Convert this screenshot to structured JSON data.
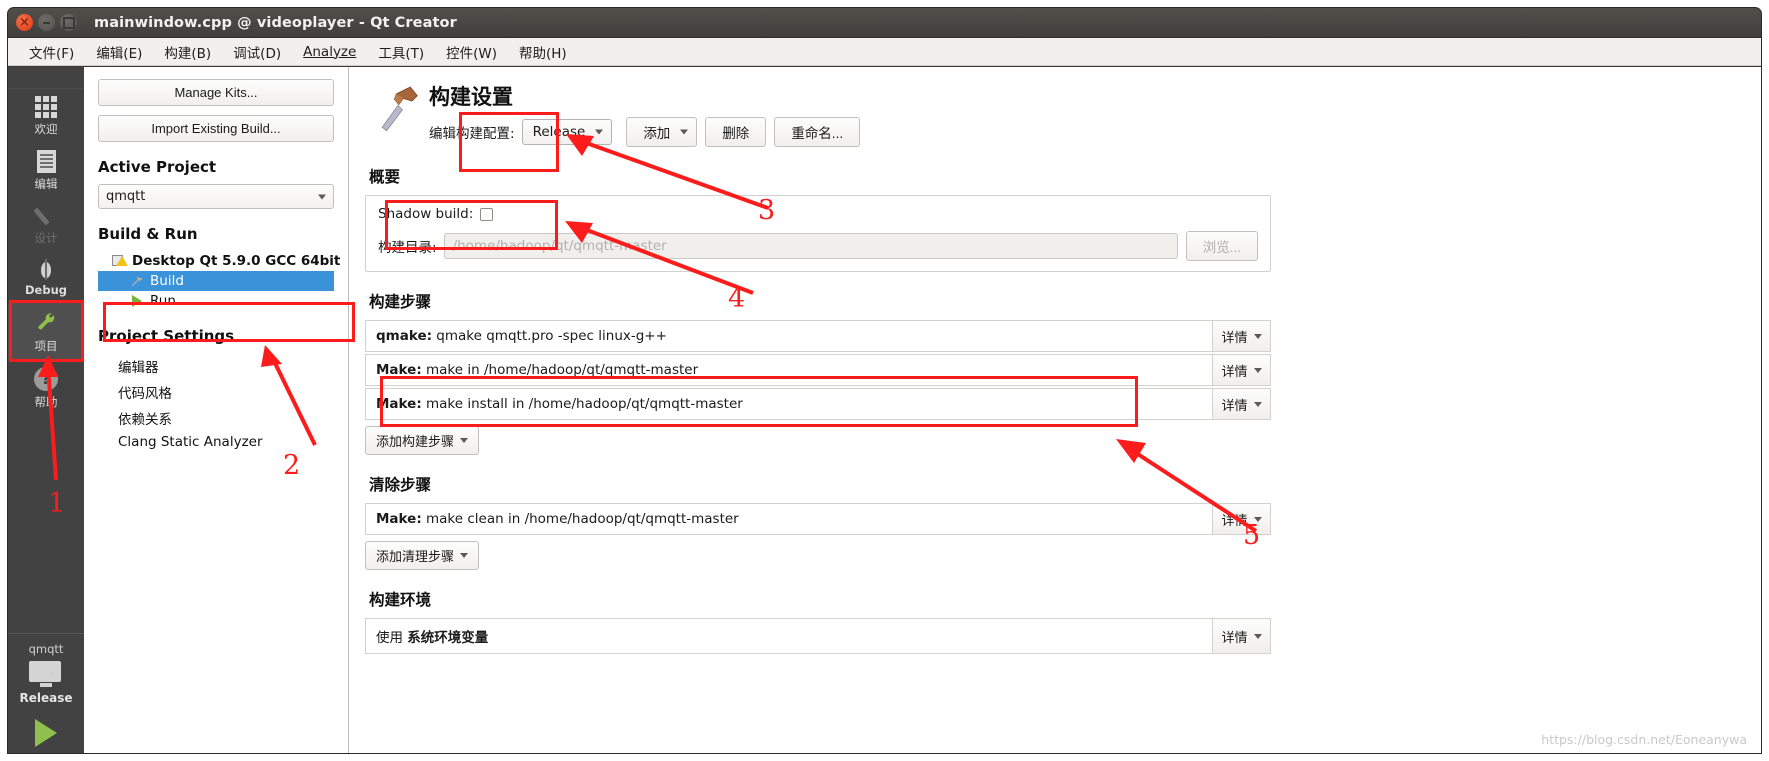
{
  "window": {
    "title": "mainwindow.cpp @ videoplayer - Qt Creator",
    "controls": {
      "close": "close-button",
      "minimize": "minimize-button",
      "maximize": "maximize-button"
    }
  },
  "menubar": {
    "items": [
      {
        "label": "文件(F)",
        "mnemonic": "F"
      },
      {
        "label": "编辑(E)",
        "mnemonic": "E"
      },
      {
        "label": "构建(B)",
        "mnemonic": "B"
      },
      {
        "label": "调试(D)",
        "mnemonic": "D"
      },
      {
        "label": "Analyze",
        "mnemonic": "A"
      },
      {
        "label": "工具(T)",
        "mnemonic": "T"
      },
      {
        "label": "控件(W)",
        "mnemonic": "W"
      },
      {
        "label": "帮助(H)",
        "mnemonic": "H"
      }
    ]
  },
  "mode_bar": {
    "items": [
      {
        "label": "欢迎",
        "icon": "grid-icon",
        "state": "normal"
      },
      {
        "label": "编辑",
        "icon": "document-icon",
        "state": "normal"
      },
      {
        "label": "设计",
        "icon": "pencil-icon",
        "state": "disabled"
      },
      {
        "label": "Debug",
        "icon": "bug-icon",
        "state": "normal"
      },
      {
        "label": "项目",
        "icon": "wrench-icon",
        "state": "selected"
      },
      {
        "label": "帮助",
        "icon": "question-mark-icon",
        "state": "normal"
      }
    ],
    "kit_selector": {
      "project": "qmqtt",
      "build_config": "Release",
      "icon": "monitor-icon",
      "run_icon": "run-triangle-icon"
    }
  },
  "project_panel": {
    "manage_kits_label": "Manage Kits...",
    "import_existing_build_label": "Import Existing Build...",
    "active_project_heading": "Active Project",
    "active_project_value": "qmqtt",
    "build_and_run_heading": "Build & Run",
    "kit_name": "Desktop Qt 5.9.0 GCC 64bit",
    "kit_children": [
      {
        "label": "Build",
        "selected": true,
        "icon": "hammer-icon"
      },
      {
        "label": "Run",
        "selected": false,
        "icon": "run-triangle-icon"
      }
    ],
    "project_settings_heading": "Project Settings",
    "project_settings_items": [
      "编辑器",
      "代码风格",
      "依赖关系",
      "Clang Static Analyzer"
    ]
  },
  "build_settings": {
    "title": "构建设置",
    "icon": "hammer-icon",
    "edit_config_label": "编辑构建配置:",
    "config_value": "Release",
    "add_label": "添加",
    "delete_label": "删除",
    "rename_label": "重命名...",
    "summary": {
      "heading": "概要",
      "shadow_build_label": "Shadow build:",
      "shadow_build_checked": false,
      "build_dir_label": "构建目录:",
      "build_dir_value": "/home/hadoop/qt/qmqtt-master",
      "browse_label": "浏览..."
    },
    "build_steps": {
      "heading": "构建步骤",
      "detail_label": "详情",
      "add_step_label": "添加构建步骤",
      "steps": [
        {
          "prefix": "qmake:",
          "text": " qmake qmqtt.pro -spec linux-g++"
        },
        {
          "prefix": "Make:",
          "text": " make in /home/hadoop/qt/qmqtt-master"
        },
        {
          "prefix": "Make:",
          "text": " make install in /home/hadoop/qt/qmqtt-master"
        }
      ]
    },
    "clean_steps": {
      "heading": "清除步骤",
      "detail_label": "详情",
      "add_step_label": "添加清理步骤",
      "steps": [
        {
          "prefix": "Make:",
          "text": " make clean in /home/hadoop/qt/qmqtt-master"
        }
      ]
    },
    "build_environment": {
      "heading": "构建环境",
      "detail_label": "详情",
      "summary_prefix": "使用 ",
      "summary_value": "系统环境变量"
    }
  },
  "annotations": {
    "color": "#fd1c1c",
    "markers": [
      {
        "number": "1",
        "target": "projects-mode-button"
      },
      {
        "number": "2",
        "target": "build-tree-item"
      },
      {
        "number": "3",
        "target": "build-configuration-combo"
      },
      {
        "number": "4",
        "target": "shadow-build-checkbox"
      },
      {
        "number": "5",
        "target": "make-install-build-step"
      }
    ]
  },
  "watermark": "https://blog.csdn.net/Eoneanywa"
}
